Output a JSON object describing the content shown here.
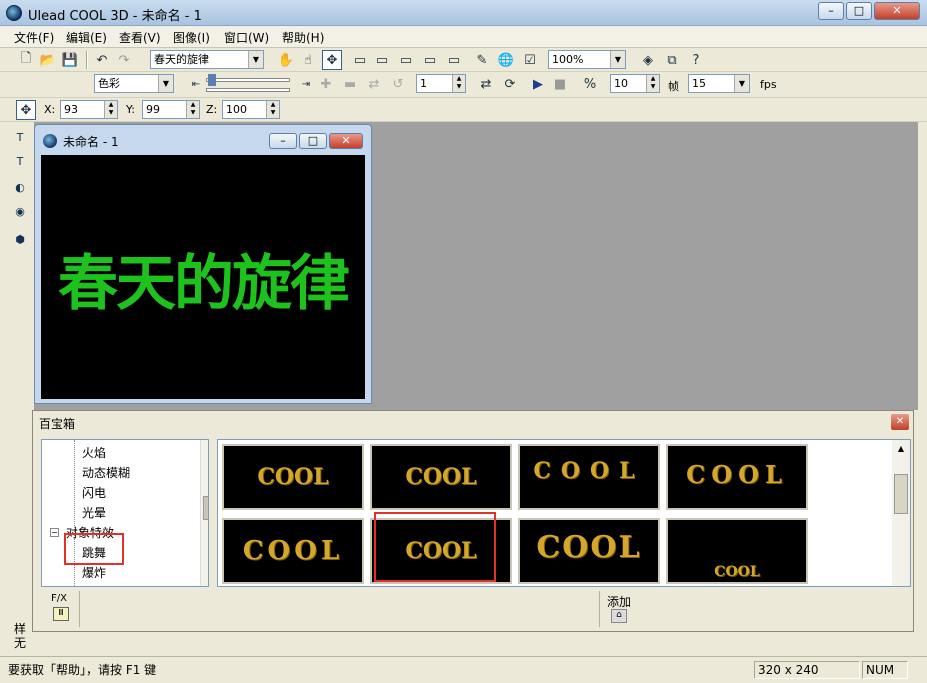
{
  "window": {
    "title": "Ulead COOL 3D - 未命名 - 1",
    "minimize": "–",
    "maximize": "□",
    "close": "✕"
  },
  "menu": [
    "文件(F)",
    "编辑(E)",
    "查看(V)",
    "图像(I)",
    "窗口(W)",
    "帮助(H)"
  ],
  "toolbar1": {
    "text_object": "春天的旋律",
    "zoom": "100%"
  },
  "toolbar2": {
    "color_mode": "色彩",
    "frame_field": "1",
    "speed_field": "10",
    "frame_label": "帧",
    "fps_field": "15",
    "fps_label": "fps"
  },
  "toolbar3": {
    "x_label": "X:",
    "x_value": "93",
    "y_label": "Y:",
    "y_value": "99",
    "z_label": "Z:",
    "z_value": "100"
  },
  "child_window": {
    "title": "未命名 - 1",
    "canvas_text": "春天的旋律",
    "canvas_text_color": "#1dc21d"
  },
  "palette": {
    "title": "百宝箱",
    "tree": {
      "items": [
        "火焰",
        "动态模糊",
        "闪电",
        "光晕"
      ],
      "group": "对象特效",
      "sub_items": [
        "跳舞",
        "爆炸"
      ]
    },
    "thumbnails": [
      "COOL",
      "COOL",
      "COOL",
      "COOL",
      "COOL",
      "COOL",
      "COOL",
      "COOL"
    ],
    "fx_label": "F/X",
    "add_label": "添加",
    "side_label_1": "样",
    "side_label_2": "无"
  },
  "status": {
    "help": "要获取「帮助」，请按 F1 键",
    "size": "320 x 240",
    "num": "NUM"
  },
  "accent_colors": {
    "highlight_box": "#e0312b",
    "thumbnail_text": "#d4a62a"
  }
}
